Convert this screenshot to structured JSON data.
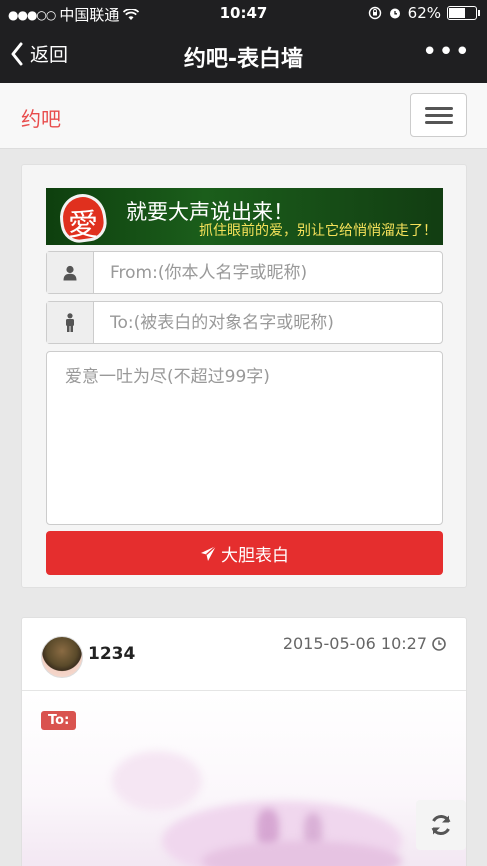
{
  "status_bar": {
    "signal_dots": "●●●○○",
    "carrier": "中国联通",
    "time": "10:47",
    "battery_percent": "62%",
    "battery_level": 0.62
  },
  "nav": {
    "back_label": "返回",
    "title": "约吧-表白墙",
    "more_label": "•••"
  },
  "site": {
    "brand": "约吧"
  },
  "banner": {
    "heart_char": "愛",
    "headline": "就要大声说出来！",
    "subline": "抓住眼前的爱，别让它给悄悄溜走了！"
  },
  "form": {
    "from_placeholder": "From:(你本人名字或昵称)",
    "to_placeholder": "To:(被表白的对象名字或昵称)",
    "message_placeholder": "爱意一吐为尽(不超过99字)",
    "submit_label": "大胆表白"
  },
  "post": {
    "username": "1234",
    "timestamp": "2015-05-06 10:27",
    "to_tag": "To:"
  },
  "colors": {
    "accent_red": "#e52e2e",
    "brand_red": "#e84c4c",
    "nav_bg": "#1f1f21"
  }
}
